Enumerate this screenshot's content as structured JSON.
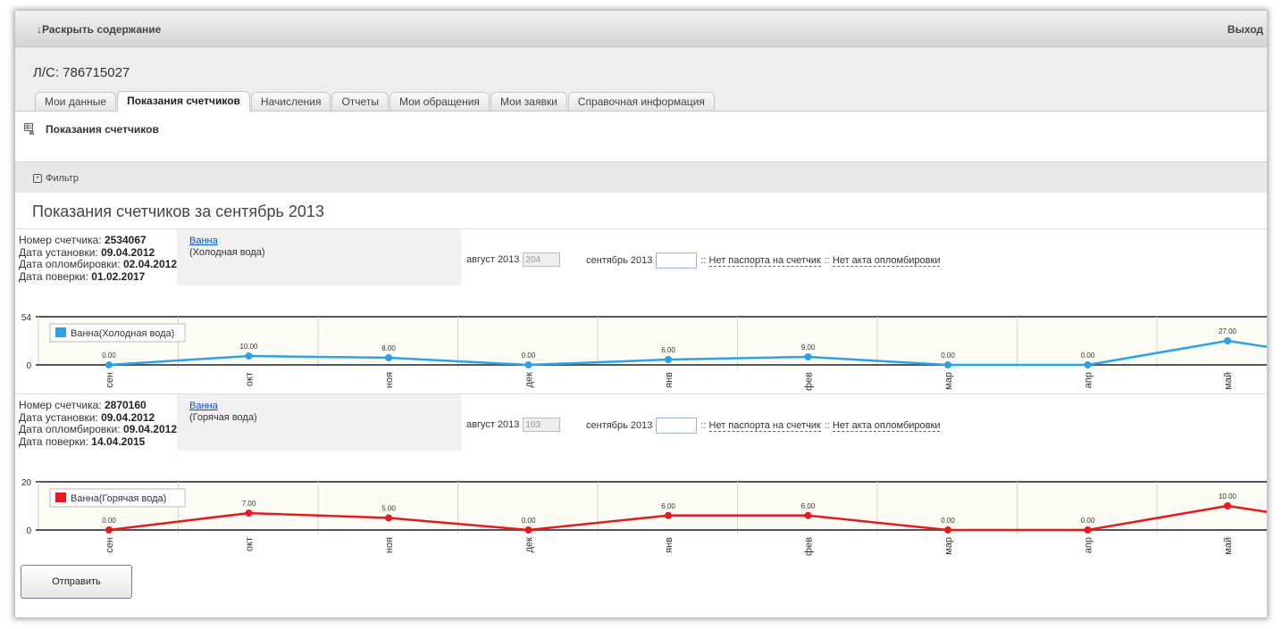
{
  "topbar": {
    "expand_label": "↓Раскрыть содержание",
    "logout_label": "Выход"
  },
  "header": {
    "account": "Л/С: 786715027"
  },
  "tabs": [
    {
      "label": "Мои данные"
    },
    {
      "label": "Показания счетчиков",
      "active": true
    },
    {
      "label": "Начисления"
    },
    {
      "label": "Отчеты"
    },
    {
      "label": "Мои обращения"
    },
    {
      "label": "Мои заявки"
    },
    {
      "label": "Справочная информация"
    }
  ],
  "section": {
    "title": "Показания счетчиков",
    "icon": "grid-icon"
  },
  "filter": {
    "label": "Фильтр",
    "icon": "expand-toggle-icon"
  },
  "period_title": "Показания счетчиков за сентябрь 2013",
  "meters": [
    {
      "number_label": "Номер счетчика:",
      "number": "2534067",
      "install_label": "Дата установки:",
      "install": "09.04.2012",
      "seal_label": "Дата опломбировки:",
      "seal": "02.04.2012",
      "check_label": "Дата поверки:",
      "check": "01.02.2017",
      "service": "Ванна",
      "service_sub": "(Холодная вода)",
      "prev_label": "август 2013",
      "prev_value": "204",
      "cur_label": "сентябрь 2013",
      "cur_value": "",
      "sep": "::",
      "link_passport": "Нет паспорта на счетчик",
      "link_seal": "Нет акта опломбировки"
    },
    {
      "number_label": "Номер счетчика:",
      "number": "2870160",
      "install_label": "Дата установки:",
      "install": "09.04.2012",
      "seal_label": "Дата опломбировки:",
      "seal": "09.04.2012",
      "check_label": "Дата поверки:",
      "check": "14.04.2015",
      "service": "Ванна",
      "service_sub": "(Горячая вода)",
      "prev_label": "август 2013",
      "prev_value": "103",
      "cur_label": "сентябрь 2013",
      "cur_value": "",
      "sep": "::",
      "link_passport": "Нет паспорта на счетчик",
      "link_seal": "Нет акта опломбировки"
    }
  ],
  "chart_data": [
    {
      "type": "line",
      "categories": [
        "сен",
        "окт",
        "ноя",
        "дек",
        "янв",
        "фев",
        "мар",
        "апр",
        "май"
      ],
      "series": [
        {
          "name": "Ванна(Холодная вода)",
          "values": [
            0,
            10,
            8,
            0,
            6,
            9,
            0,
            0,
            27
          ],
          "color": "#2ba2e8"
        }
      ],
      "data_labels": [
        "0.00",
        "10.00",
        "8.00",
        "0.00",
        "6.00",
        "9.00",
        "0.00",
        "0.00",
        "27.00"
      ],
      "ylim": [
        0,
        54
      ],
      "y_ticks": [
        "0",
        "54"
      ],
      "legend": "top-left",
      "grid": true
    },
    {
      "type": "line",
      "categories": [
        "сен",
        "окт",
        "ноя",
        "дек",
        "янв",
        "фев",
        "мар",
        "апр",
        "май"
      ],
      "series": [
        {
          "name": "Ванна(Горячая вода)",
          "values": [
            0,
            7,
            5,
            0,
            6,
            6,
            0,
            0,
            10
          ],
          "color": "#e8191d"
        }
      ],
      "data_labels": [
        "0.00",
        "7.00",
        "5.00",
        "0.00",
        "6.00",
        "6.00",
        "0.00",
        "0.00",
        "10.00"
      ],
      "ylim": [
        0,
        20
      ],
      "y_ticks": [
        "0",
        "20"
      ],
      "legend": "top-left",
      "grid": true
    }
  ],
  "submit_label": "Отправить"
}
